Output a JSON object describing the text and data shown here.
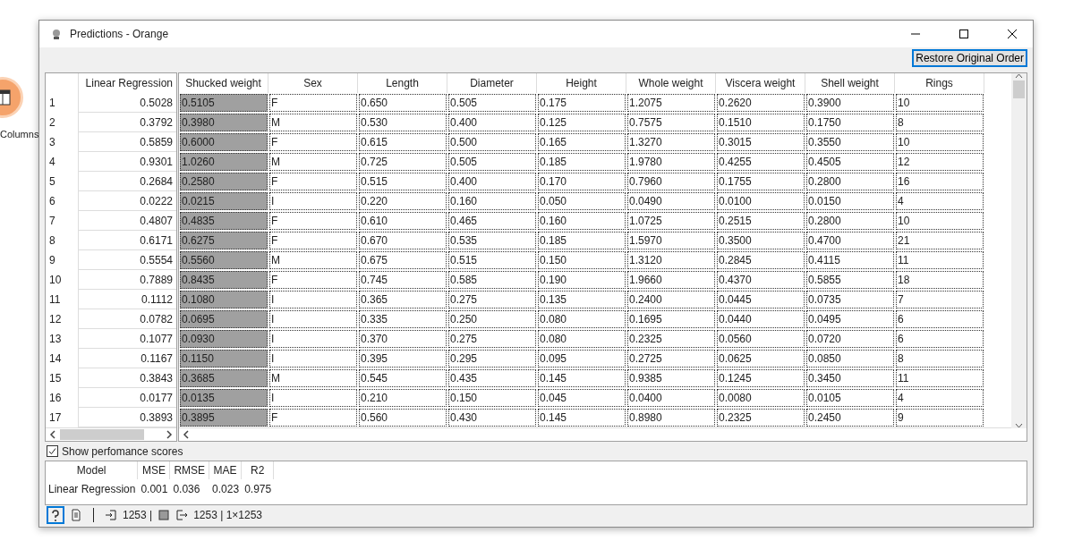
{
  "canvas": {
    "widget_label": "Columns"
  },
  "window": {
    "title": "Predictions - Orange"
  },
  "toolbar": {
    "restore_button": "Restore Original Order"
  },
  "predictions_header": "Linear Regression",
  "columns": [
    {
      "label": "Shucked weight",
      "highlighted": true
    },
    {
      "label": "Sex",
      "highlighted": false
    },
    {
      "label": "Length",
      "highlighted": false
    },
    {
      "label": "Diameter",
      "highlighted": false
    },
    {
      "label": "Height",
      "highlighted": false
    },
    {
      "label": "Whole weight",
      "highlighted": false
    },
    {
      "label": "Viscera weight",
      "highlighted": false
    },
    {
      "label": "Shell weight",
      "highlighted": false
    },
    {
      "label": "Rings",
      "highlighted": false
    }
  ],
  "rows": [
    {
      "number": "1",
      "prediction": "0.5028",
      "cells": [
        "0.5105",
        "F",
        "0.650",
        "0.505",
        "0.175",
        "1.2075",
        "0.2620",
        "0.3900",
        "10"
      ]
    },
    {
      "number": "2",
      "prediction": "0.3792",
      "cells": [
        "0.3980",
        "M",
        "0.530",
        "0.400",
        "0.125",
        "0.7575",
        "0.1510",
        "0.1750",
        "8"
      ]
    },
    {
      "number": "3",
      "prediction": "0.5859",
      "cells": [
        "0.6000",
        "F",
        "0.615",
        "0.500",
        "0.165",
        "1.3270",
        "0.3015",
        "0.3550",
        "10"
      ]
    },
    {
      "number": "4",
      "prediction": "0.9301",
      "cells": [
        "1.0260",
        "M",
        "0.725",
        "0.505",
        "0.185",
        "1.9780",
        "0.4255",
        "0.4505",
        "12"
      ]
    },
    {
      "number": "5",
      "prediction": "0.2684",
      "cells": [
        "0.2580",
        "F",
        "0.515",
        "0.400",
        "0.170",
        "0.7960",
        "0.1755",
        "0.2800",
        "16"
      ]
    },
    {
      "number": "6",
      "prediction": "0.0222",
      "cells": [
        "0.0215",
        "I",
        "0.220",
        "0.160",
        "0.050",
        "0.0490",
        "0.0100",
        "0.0150",
        "4"
      ]
    },
    {
      "number": "7",
      "prediction": "0.4807",
      "cells": [
        "0.4835",
        "F",
        "0.610",
        "0.465",
        "0.160",
        "1.0725",
        "0.2515",
        "0.2800",
        "10"
      ]
    },
    {
      "number": "8",
      "prediction": "0.6171",
      "cells": [
        "0.6275",
        "F",
        "0.670",
        "0.535",
        "0.185",
        "1.5970",
        "0.3500",
        "0.4700",
        "21"
      ]
    },
    {
      "number": "9",
      "prediction": "0.5554",
      "cells": [
        "0.5560",
        "M",
        "0.675",
        "0.515",
        "0.150",
        "1.3120",
        "0.2845",
        "0.4115",
        "11"
      ]
    },
    {
      "number": "10",
      "prediction": "0.7889",
      "cells": [
        "0.8435",
        "F",
        "0.745",
        "0.585",
        "0.190",
        "1.9660",
        "0.4370",
        "0.5855",
        "18"
      ]
    },
    {
      "number": "11",
      "prediction": "0.1112",
      "cells": [
        "0.1080",
        "I",
        "0.365",
        "0.275",
        "0.135",
        "0.2400",
        "0.0445",
        "0.0735",
        "7"
      ]
    },
    {
      "number": "12",
      "prediction": "0.0782",
      "cells": [
        "0.0695",
        "I",
        "0.335",
        "0.250",
        "0.080",
        "0.1695",
        "0.0440",
        "0.0495",
        "6"
      ]
    },
    {
      "number": "13",
      "prediction": "0.1077",
      "cells": [
        "0.0930",
        "I",
        "0.370",
        "0.275",
        "0.080",
        "0.2325",
        "0.0560",
        "0.0720",
        "6"
      ]
    },
    {
      "number": "14",
      "prediction": "0.1167",
      "cells": [
        "0.1150",
        "I",
        "0.395",
        "0.295",
        "0.095",
        "0.2725",
        "0.0625",
        "0.0850",
        "8"
      ]
    },
    {
      "number": "15",
      "prediction": "0.3843",
      "cells": [
        "0.3685",
        "M",
        "0.545",
        "0.435",
        "0.145",
        "0.9385",
        "0.1245",
        "0.3450",
        "11"
      ]
    },
    {
      "number": "16",
      "prediction": "0.0177",
      "cells": [
        "0.0135",
        "I",
        "0.210",
        "0.150",
        "0.045",
        "0.0400",
        "0.0080",
        "0.0105",
        "4"
      ]
    },
    {
      "number": "17",
      "prediction": "0.3893",
      "cells": [
        "0.3895",
        "F",
        "0.560",
        "0.430",
        "0.145",
        "0.8980",
        "0.2325",
        "0.2450",
        "9"
      ]
    }
  ],
  "show_scores": {
    "label": "Show perfomance scores",
    "checked": true
  },
  "scores": {
    "columns": [
      "Model",
      "MSE",
      "RMSE",
      "MAE",
      "R2"
    ],
    "rows": [
      [
        "Linear Regression",
        "0.001",
        "0.036",
        "0.023",
        "0.975"
      ]
    ]
  },
  "status_bar": {
    "input": "1253 |",
    "output": "1253 | 1×1253"
  }
}
